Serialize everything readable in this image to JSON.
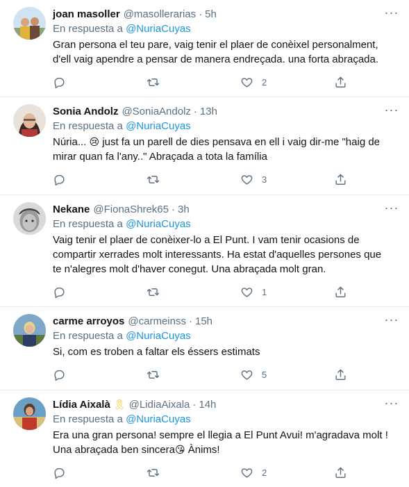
{
  "reply_prefix": "En respuesta a",
  "dot": "·",
  "more_icon": "more-horizontal-icon",
  "tweets": [
    {
      "name": "joan masoller",
      "handle": "@masollerarias",
      "time": "5h",
      "mention": "@NuriaCuyas",
      "text": "Gran persona el teu pare, vaig tenir el plaer de conèixel personalment, d'ell vaig apendre a pensar de manera endreçada. una forta abraçada.",
      "likes": "2"
    },
    {
      "name": "Sonia Andolz",
      "handle": "@SoniaAndolz",
      "time": "13h",
      "mention": "@NuriaCuyas",
      "text_pre": "Núria... ",
      "emoji": "😢",
      "text_post": " just fa un parell de dies pensava en ell i vaig dir-me \"haig de mirar quan fa l'any..\" Abraçada a tota la família",
      "likes": "3"
    },
    {
      "name": "Nekane",
      "handle": "@FionaShrek65",
      "time": "3h",
      "mention": "@NuriaCuyas",
      "text": "Vaig tenir el plaer de conèixer-lo a El Punt. I vam tenir ocasions de compartir xerrades molt interessants. Ha estat d'aquelles persones que te n'alegres molt d'haver conegut. Una abraçada molt gran.",
      "likes": "1"
    },
    {
      "name": "carme arroyos",
      "handle": "@carmeinss",
      "time": "15h",
      "mention": "@NuriaCuyas",
      "text": "Si, com es troben a faltar els éssers estimats",
      "likes": "5"
    },
    {
      "name": "Lídia Aixalà",
      "badge": "🎗",
      "handle": "@LidiaAixala",
      "time": "14h",
      "mention": "@NuriaCuyas",
      "text_pre": "Era una gran persona! sempre el llegia a El Punt Avui! m'agradava molt ! Una abraçada ben sincera",
      "emoji": "😘",
      "text_post": " Ànims!",
      "likes": "2"
    }
  ]
}
